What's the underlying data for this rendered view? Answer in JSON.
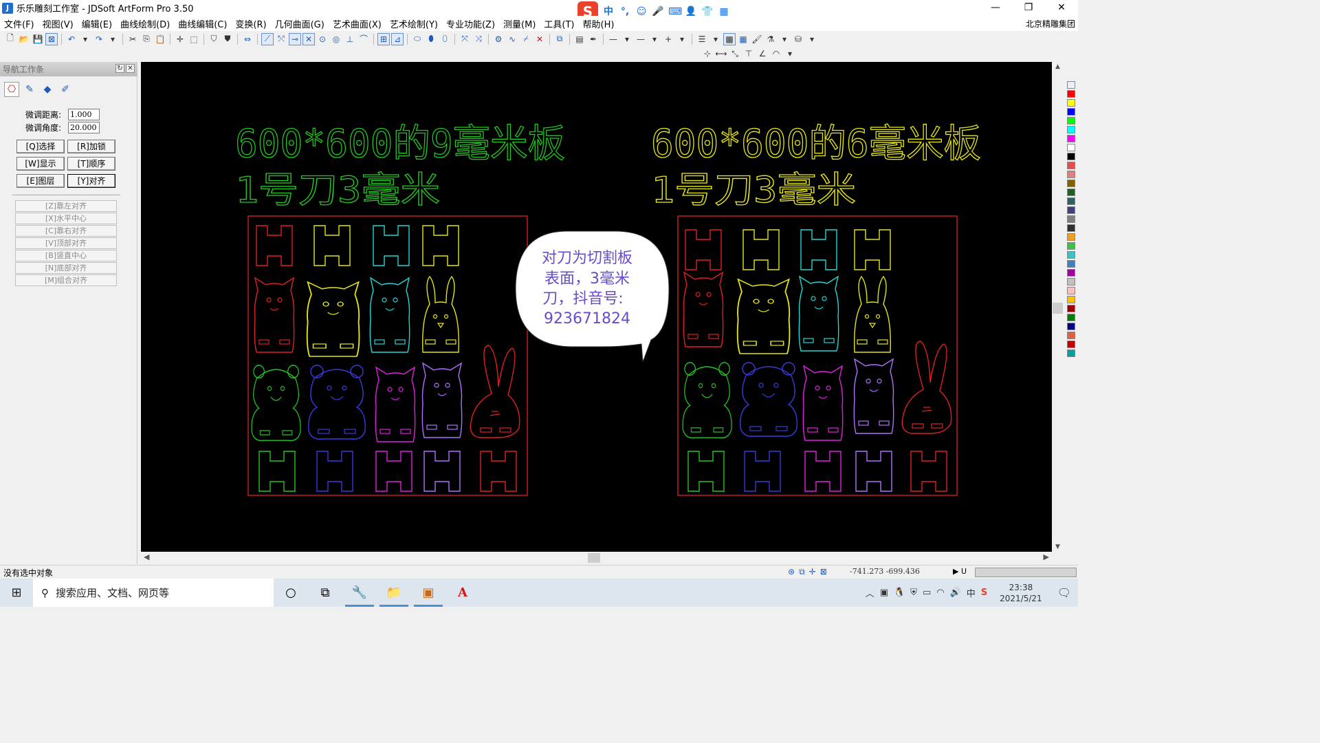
{
  "window": {
    "title": "乐乐雕刻工作室 - JDSoft ArtForm Pro 3.50",
    "controls": [
      "—",
      "❐",
      "✕"
    ]
  },
  "ime": {
    "logo": "S",
    "mode": "中",
    "punct": "°,",
    "items": [
      "☺",
      "🎤",
      "⌨",
      "👤",
      "👕",
      "▦"
    ]
  },
  "menu": {
    "items": [
      "文件(F)",
      "视图(V)",
      "编辑(E)",
      "曲线绘制(D)",
      "曲线编辑(C)",
      "变换(R)",
      "几何曲面(G)",
      "艺术曲面(X)",
      "艺术绘制(Y)",
      "专业功能(Z)",
      "测量(M)",
      "工具(T)",
      "帮助(H)"
    ],
    "company": "北京精雕集团"
  },
  "nav": {
    "header": "导航工作条",
    "tabs": [
      "⎔",
      "✎",
      "◆",
      "✐"
    ],
    "fine_distance_label": "微调距离:",
    "fine_distance_value": "1.000",
    "fine_angle_label": "微调角度:",
    "fine_angle_value": "20.000",
    "buttons": [
      "[Q]选择",
      "[R]加锁",
      "[W]显示",
      "[T]顺序",
      "[E]图层",
      "[Y]对齐"
    ],
    "align_items": [
      "[Z]靠左对齐",
      "[X]水平中心",
      "[C]靠右对齐",
      "[V]顶部对齐",
      "[B]竖直中心",
      "[N]底部对齐",
      "[M]组合对齐"
    ]
  },
  "canvas": {
    "left_title_line1": "600*600的9毫米板",
    "left_title_line2": "1号刀3毫米",
    "right_title_line1": "600*600的6毫米板",
    "right_title_line2": "1号刀3毫米",
    "bubble_line1": "对刀为切割板",
    "bubble_line2": "表面，3毫米",
    "bubble_line3": "刀，抖音号:",
    "bubble_line4": "923671824",
    "colors": {
      "green": "#22c822",
      "yellow": "#e6e619",
      "red": "#e02020",
      "cyan": "#20d8d8",
      "blue": "#3a3ae0",
      "magenta": "#e020e0",
      "purple": "#b070ff",
      "bubble_text": "#6a4cc8"
    }
  },
  "palette": [
    "#e8f0f8",
    "#ff0000",
    "#ffff00",
    "#0000ff",
    "#00ff00",
    "#00ffff",
    "#ff00ff",
    "#ffffff",
    "#000000",
    "#e05050",
    "#e08080",
    "#806000",
    "#206020",
    "#306060",
    "#404080",
    "#808080",
    "#303030",
    "#f0a020",
    "#40c040",
    "#40c0c0",
    "#4080c0",
    "#a000a0",
    "#c0c0c0",
    "#ffc0c0",
    "#ffc000",
    "#a00000",
    "#008000",
    "#000080",
    "#e06040",
    "#c00000",
    "#00a0a0"
  ],
  "status": {
    "message": "没有选中对象",
    "coords": "-741.273  -699.436",
    "unit": "▶ U"
  },
  "taskbar": {
    "search_placeholder": "搜索应用、文档、网页等",
    "time": "23:38",
    "date": "2021/5/21",
    "ime_indicator": "中",
    "apps": [
      "○",
      "⧉",
      "🔧",
      "📁",
      "▣",
      "A"
    ]
  }
}
